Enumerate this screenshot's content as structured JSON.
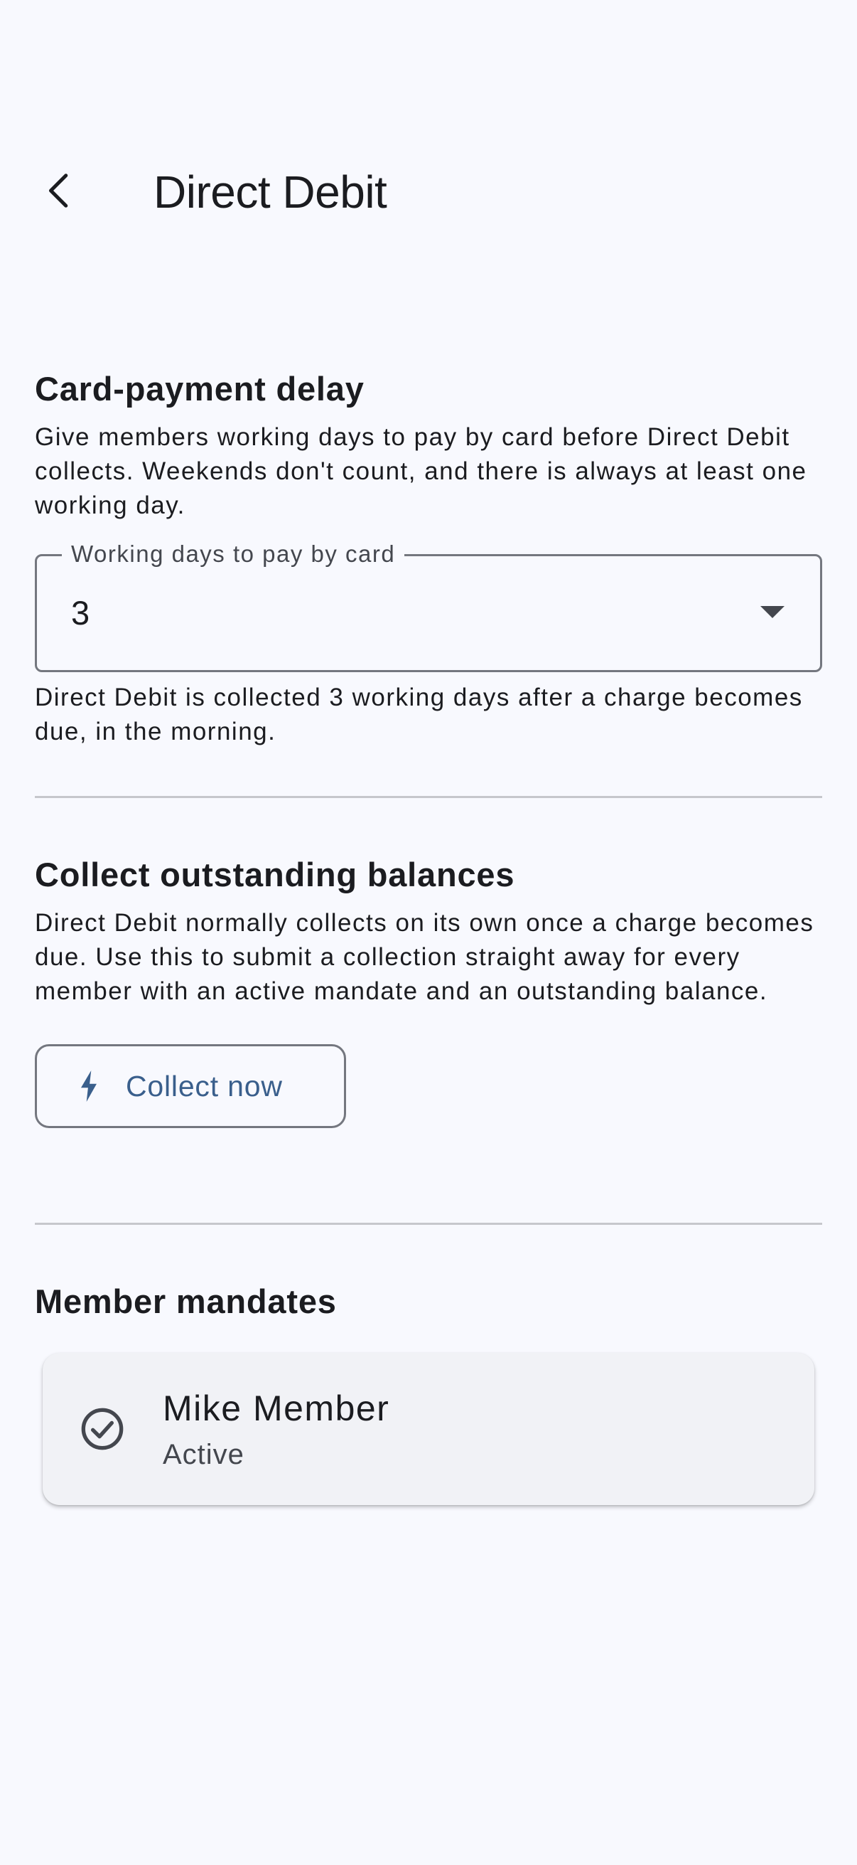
{
  "app_bar": {
    "title": "Direct Debit",
    "back_icon": "arrow-back-icon"
  },
  "card_payment_delay": {
    "heading": "Card-payment delay",
    "description": "Give members working days to pay by card before Direct Debit collects. Weekends don't count, and there is always at least one working day.",
    "field_label": "Working days to pay by card",
    "field_value": "3",
    "dropdown_icon": "arrow-drop-down-icon",
    "helper": "Direct Debit is collected 3 working days after a charge becomes due, in the morning."
  },
  "collect_outstanding": {
    "heading": "Collect outstanding balances",
    "description": "Direct Debit normally collects on its own once a charge becomes due. Use this to submit a collection straight away for every member with an active mandate and an outstanding balance.",
    "button_label": "Collect now",
    "button_icon": "bolt-icon"
  },
  "member_mandates": {
    "heading": "Member mandates",
    "items": [
      {
        "name": "Mike Member",
        "status": "Active",
        "icon": "check-circle-icon"
      }
    ]
  },
  "colors": {
    "background": "#f8f9fe",
    "accent": "#3a5f8c",
    "outline": "#74777f",
    "divider": "#c6c7cc",
    "card": "#f1f2f6"
  }
}
